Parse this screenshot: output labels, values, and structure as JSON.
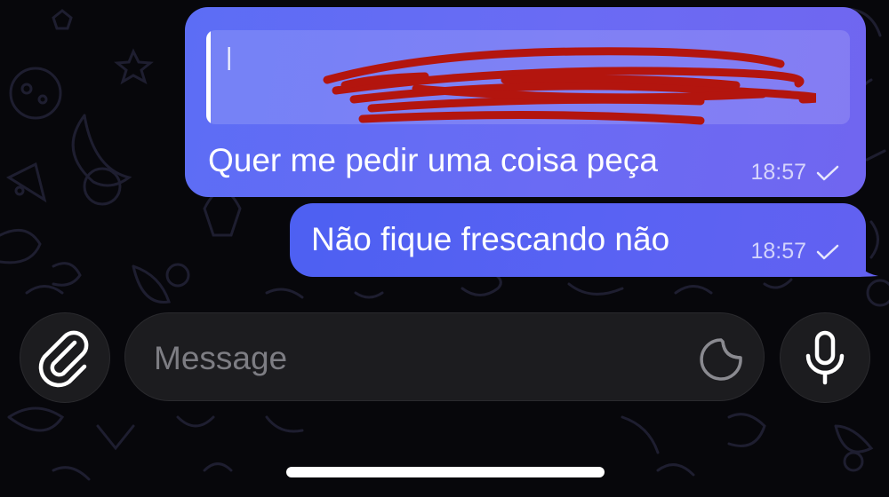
{
  "colors": {
    "background": "#07070b",
    "bubble_outgoing": "#5c6df5",
    "input_background": "#1c1c1f",
    "placeholder": "#7d7d83"
  },
  "messages": [
    {
      "has_reply_quote": true,
      "reply_redacted": true,
      "text": "Quer me pedir uma coisa peça",
      "time": "18:57",
      "status_icon": "single-check-icon"
    },
    {
      "has_reply_quote": false,
      "text": "Não fique frescando não",
      "time": "18:57",
      "status_icon": "single-check-icon"
    }
  ],
  "composer": {
    "placeholder": "Message",
    "value": "",
    "attach_icon": "paperclip-icon",
    "sticker_icon": "sticker-icon",
    "voice_icon": "microphone-icon"
  }
}
